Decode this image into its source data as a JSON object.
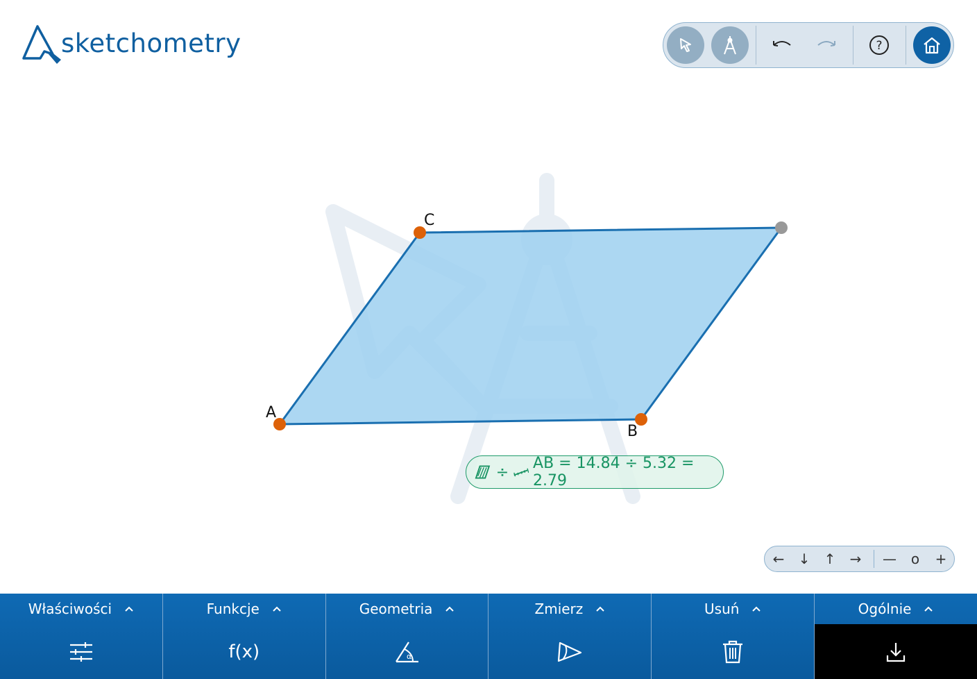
{
  "app": {
    "name": "sketchometry"
  },
  "toolbar": {
    "buttons": [
      {
        "name": "select",
        "icon": "cursor-icon"
      },
      {
        "name": "construct",
        "icon": "compass-icon"
      },
      {
        "name": "undo",
        "icon": "undo-icon"
      },
      {
        "name": "redo",
        "icon": "redo-icon"
      },
      {
        "name": "help",
        "icon": "help-icon"
      },
      {
        "name": "home",
        "icon": "home-icon"
      }
    ]
  },
  "construction": {
    "points": [
      {
        "label": "A",
        "color": "#dd6108"
      },
      {
        "label": "B",
        "color": "#dd6108"
      },
      {
        "label": "C",
        "color": "#dd6108"
      },
      {
        "label": "",
        "color": "#999999"
      }
    ],
    "fill_color": "#a9d6f2",
    "stroke_color": "#1a6fb0"
  },
  "measurement": {
    "division_sign": "÷",
    "text": "AB = 14.84 ÷ 5.32 = 2.79",
    "color": "#189463"
  },
  "navigation": {
    "left": "←",
    "down": "↓",
    "up": "↑",
    "right": "→",
    "zoom_out": "—",
    "reset": "o",
    "zoom_in": "+"
  },
  "bottom_tabs": [
    {
      "label": "Właściwości",
      "icon": "sliders-icon"
    },
    {
      "label": "Funkcje",
      "icon_text": "f(x)"
    },
    {
      "label": "Geometria",
      "icon": "angle-icon"
    },
    {
      "label": "Zmierz",
      "icon": "protractor-icon"
    },
    {
      "label": "Usuń",
      "icon": "trash-icon"
    },
    {
      "label": "Ogólnie",
      "icon": "download-icon",
      "active": true
    }
  ],
  "colors": {
    "brand": "#0f5fa0",
    "bar": "#0f6ab4",
    "active_tab": "#000000"
  }
}
